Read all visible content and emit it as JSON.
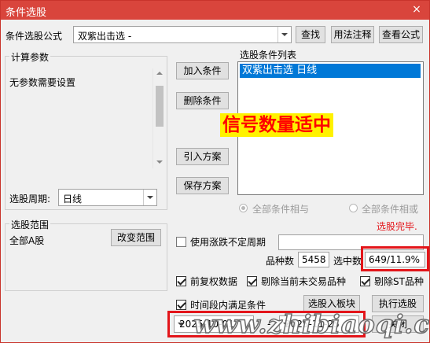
{
  "window": {
    "title": "条件选股",
    "close_symbol": "×"
  },
  "formula": {
    "label": "条件选股公式",
    "value": "双紫出击选  -",
    "buttons": {
      "find": "查找",
      "usage": "用法注释",
      "view": "查看公式"
    }
  },
  "params": {
    "legend": "计算参数",
    "text": "无参数需要设置",
    "period_label": "选股周期:",
    "period_value": "日线"
  },
  "actions": {
    "add": "加入条件",
    "delete": "删除条件",
    "import": "引入方案",
    "save": "保存方案"
  },
  "condition_list": {
    "legend": "选股条件列表",
    "items": [
      "双紫出击选  日线"
    ]
  },
  "annotation": "信号数量适中",
  "logic": {
    "and": "全部条件相与",
    "or": "全部条件相或"
  },
  "status": {
    "done": "选股完毕."
  },
  "range": {
    "legend": "选股范围",
    "value": "全部A股",
    "change_button": "改变范围"
  },
  "options": {
    "variable_period": "使用涨跌不定周期",
    "variable_period_value": "",
    "count_label": "品种数",
    "count_value": "5458",
    "selected_label": "选中数",
    "selected_value": "649/11.9%",
    "adjusted": "前复权数据",
    "exclude_suspended": "剔除当前未交易品种",
    "exclude_st": "剔除ST品种",
    "time_range": "时间段内满足条件"
  },
  "bottom": {
    "to_block": "选股入板块",
    "execute": "执行选股",
    "close": "关闭",
    "date_from": "2025-10-01",
    "date_sep": "-",
    "date_to": "2025-11-25"
  },
  "watermark": "www.zhibiaoqi.com",
  "colors": {
    "titlebar": "#d9453c",
    "selection": "#0078d7",
    "highlight_border": "#e3151a",
    "annotation_text": "#ff0000",
    "annotation_bg": "#fff200",
    "status_text": "#e3151a"
  }
}
